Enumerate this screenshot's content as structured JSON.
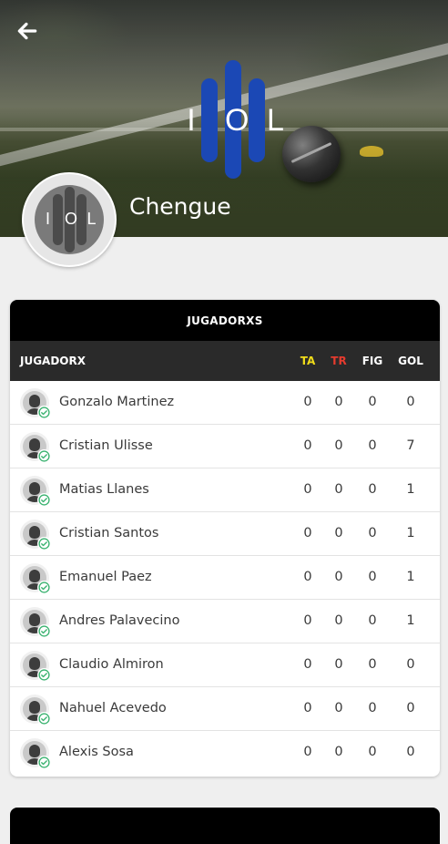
{
  "header": {
    "back_icon": "arrow-left-icon",
    "logo_letters": [
      "I",
      "O",
      "L"
    ],
    "team_name": "Chengue"
  },
  "roster": {
    "title": "JUGADORXS",
    "columns": {
      "player": "JUGADORX",
      "ta": "TA",
      "tr": "TR",
      "fig": "FIG",
      "gol": "GOL"
    },
    "column_colors": {
      "ta": "#f0dc1a",
      "tr": "#e53b2e"
    },
    "players": [
      {
        "name": "Gonzalo Martinez",
        "ta": "0",
        "tr": "0",
        "fig": "0",
        "gol": "0"
      },
      {
        "name": "Cristian Ulisse",
        "ta": "0",
        "tr": "0",
        "fig": "0",
        "gol": "7"
      },
      {
        "name": "Matias Llanes",
        "ta": "0",
        "tr": "0",
        "fig": "0",
        "gol": "1"
      },
      {
        "name": "Cristian Santos",
        "ta": "0",
        "tr": "0",
        "fig": "0",
        "gol": "1"
      },
      {
        "name": "Emanuel Paez",
        "ta": "0",
        "tr": "0",
        "fig": "0",
        "gol": "1"
      },
      {
        "name": "Andres Palavecino",
        "ta": "0",
        "tr": "0",
        "fig": "0",
        "gol": "1"
      },
      {
        "name": "Claudio Almiron",
        "ta": "0",
        "tr": "0",
        "fig": "0",
        "gol": "0"
      },
      {
        "name": "Nahuel Acevedo",
        "ta": "0",
        "tr": "0",
        "fig": "0",
        "gol": "0"
      },
      {
        "name": "Alexis Sosa",
        "ta": "0",
        "tr": "0",
        "fig": "0",
        "gol": "0"
      }
    ]
  },
  "colors": {
    "brand_blue": "#1b48b5",
    "verified_green": "#3cb371"
  }
}
